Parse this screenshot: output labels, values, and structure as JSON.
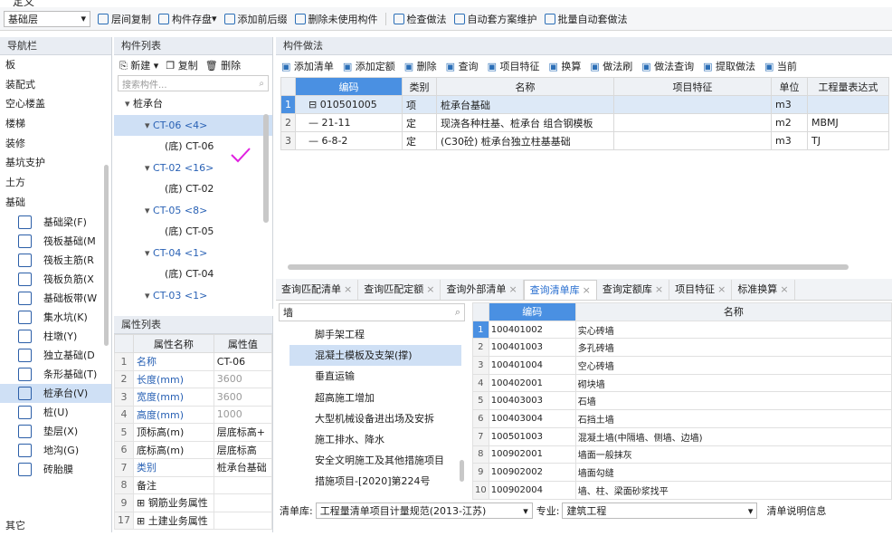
{
  "top_partial_label": "定义",
  "toolbar": {
    "floor": "基础层",
    "items": [
      "层间复制",
      "构件存盘",
      "添加前后缀",
      "删除未使用构件",
      "检查做法",
      "自动套方案维护",
      "批量自动套做法"
    ]
  },
  "nav": {
    "title": "导航栏",
    "items": [
      "板",
      "装配式",
      "空心楼盖",
      "楼梯",
      "装修",
      "基坑支护",
      "土方",
      "基础"
    ],
    "sub_items": [
      {
        "label": "基础梁(F)",
        "icon": "foundation-beam-icon"
      },
      {
        "label": "筏板基础(M",
        "icon": "raft-foundation-icon"
      },
      {
        "label": "筏板主筋(R",
        "icon": "raft-main-rebar-icon"
      },
      {
        "label": "筏板负筋(X",
        "icon": "raft-negative-rebar-icon"
      },
      {
        "label": "基础板带(W",
        "icon": "foundation-strip-icon"
      },
      {
        "label": "集水坑(K)",
        "icon": "sump-pit-icon"
      },
      {
        "label": "柱墩(Y)",
        "icon": "column-pier-icon"
      },
      {
        "label": "独立基础(D",
        "icon": "isolated-foundation-icon"
      },
      {
        "label": "条形基础(T)",
        "icon": "strip-foundation-icon"
      },
      {
        "label": "桩承台(V)",
        "icon": "pile-cap-icon"
      },
      {
        "label": "桩(U)",
        "icon": "pile-icon"
      },
      {
        "label": "垫层(X)",
        "icon": "cushion-icon"
      },
      {
        "label": "地沟(G)",
        "icon": "trench-icon"
      },
      {
        "label": "砖胎膜",
        "icon": "brick-mold-icon"
      }
    ],
    "bottom": "其它"
  },
  "component_list": {
    "title": "构件列表",
    "new": "新建",
    "copy": "复制",
    "delete": "删除",
    "search_placeholder": "搜索构件...",
    "tree": [
      {
        "label": "桩承台",
        "level": 0
      },
      {
        "label": "CT-06 <4>",
        "level": 1,
        "selected": true
      },
      {
        "label": "(底) CT-06",
        "level": 2
      },
      {
        "label": "CT-02 <16>",
        "level": 1
      },
      {
        "label": "(底) CT-02",
        "level": 2
      },
      {
        "label": "CT-05 <8>",
        "level": 1
      },
      {
        "label": "(底) CT-05",
        "level": 2
      },
      {
        "label": "CT-04 <1>",
        "level": 1
      },
      {
        "label": "(底) CT-04",
        "level": 2
      },
      {
        "label": "CT-03 <1>",
        "level": 1
      }
    ]
  },
  "props": {
    "title": "属性列表",
    "col_name": "属性名称",
    "col_value": "属性值",
    "rows": [
      {
        "n": "1",
        "name": "名称",
        "value": "CT-06",
        "blue": true,
        "gray": false
      },
      {
        "n": "2",
        "name": "长度(mm)",
        "value": "3600",
        "blue": true,
        "gray": true
      },
      {
        "n": "3",
        "name": "宽度(mm)",
        "value": "3600",
        "blue": true,
        "gray": true
      },
      {
        "n": "4",
        "name": "高度(mm)",
        "value": "1000",
        "blue": true,
        "gray": true
      },
      {
        "n": "5",
        "name": "顶标高(m)",
        "value": "层底标高+",
        "blue": false,
        "gray": false
      },
      {
        "n": "6",
        "name": "底标高(m)",
        "value": "层底标高",
        "blue": false,
        "gray": false
      },
      {
        "n": "7",
        "name": "类别",
        "value": "桩承台基础",
        "blue": true,
        "gray": false
      },
      {
        "n": "8",
        "name": "备注",
        "value": "",
        "blue": false,
        "gray": false
      },
      {
        "n": "9",
        "name": "钢筋业务属性",
        "value": "",
        "blue": false,
        "gray": false
      },
      {
        "n": "17",
        "name": "土建业务属性",
        "value": "",
        "blue": false,
        "gray": false
      }
    ]
  },
  "method": {
    "title": "构件做法",
    "tools": [
      "添加清单",
      "添加定额",
      "删除",
      "查询",
      "项目特征",
      "换算",
      "做法刷",
      "做法查询",
      "提取做法",
      "当前"
    ],
    "headers": [
      "编码",
      "类别",
      "名称",
      "项目特征",
      "单位",
      "工程量表达式"
    ],
    "rows": [
      {
        "n": "1",
        "code": "010501005",
        "cat": "项",
        "name": "桩承台基础",
        "feature": "",
        "unit": "m3",
        "expr": ""
      },
      {
        "n": "2",
        "code": "21-11",
        "cat": "定",
        "name": "现浇各种柱基、桩承台 组合钢模板",
        "feature": "",
        "unit": "m2",
        "expr": "MBMJ"
      },
      {
        "n": "3",
        "code": "6-8-2",
        "cat": "定",
        "name": "(C30砼) 桩承台独立柱基基础",
        "feature": "",
        "unit": "m3",
        "expr": "TJ"
      }
    ]
  },
  "bottom_tabs": [
    "查询匹配清单",
    "查询匹配定额",
    "查询外部清单",
    "查询清单库",
    "查询定额库",
    "项目特征",
    "标准换算"
  ],
  "active_tab": "查询清单库",
  "lib_search": "墙",
  "lib_list": [
    "脚手架工程",
    "混凝土模板及支架(撑)",
    "垂直运输",
    "超高施工增加",
    "大型机械设备进出场及安拆",
    "施工排水、降水",
    "安全文明施工及其他措施项目",
    "措施项目-[2020]第224号"
  ],
  "lib_table": {
    "headers": [
      "编码",
      "名称"
    ],
    "rows": [
      {
        "n": "1",
        "code": "100401002",
        "name": "实心砖墙"
      },
      {
        "n": "2",
        "code": "100401003",
        "name": "多孔砖墙"
      },
      {
        "n": "3",
        "code": "100401004",
        "name": "空心砖墙"
      },
      {
        "n": "4",
        "code": "100402001",
        "name": "砌块墙"
      },
      {
        "n": "5",
        "code": "100403003",
        "name": "石墙"
      },
      {
        "n": "6",
        "code": "100403004",
        "name": "石挡土墙"
      },
      {
        "n": "7",
        "code": "100501003",
        "name": "混凝土墙(中隔墙、侧墙、边墙)"
      },
      {
        "n": "8",
        "code": "100902001",
        "name": "墙面一般抹灰"
      },
      {
        "n": "9",
        "code": "100902002",
        "name": "墙面勾缝"
      },
      {
        "n": "10",
        "code": "100902004",
        "name": "墙、柱、梁面砂浆找平"
      }
    ]
  },
  "bottom_bar": {
    "lib_label": "清单库:",
    "lib_value": "工程量清单项目计量规范(2013-江苏)",
    "spec_label": "专业:",
    "spec_value": "建筑工程",
    "info": "清单说明信息"
  },
  "colors": {
    "accent": "#4a90e2",
    "selection": "#cfe0f5",
    "check_mark": "#e020e0"
  }
}
